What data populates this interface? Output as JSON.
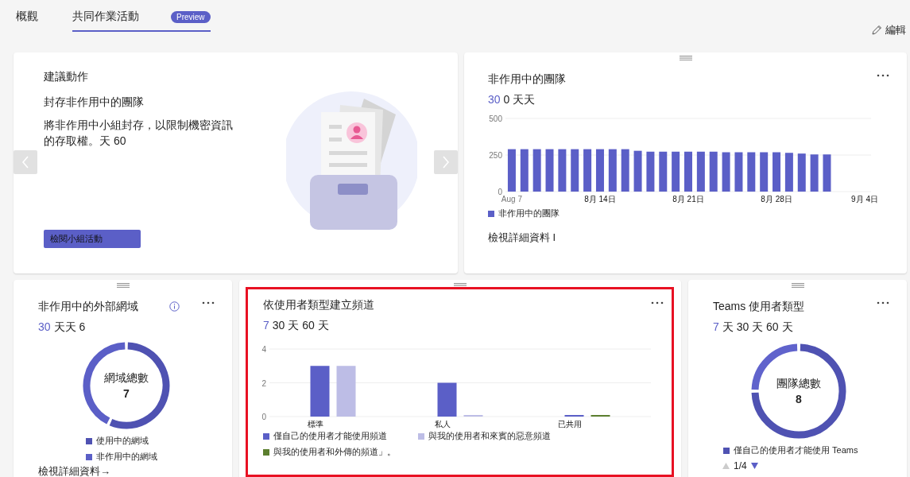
{
  "tabs": [
    {
      "label": "概觀",
      "selected": false
    },
    {
      "label": "共同作業活動",
      "selected": true,
      "badge": "Preview"
    }
  ],
  "edit_button": {
    "label": "編輯"
  },
  "action_card": {
    "title": "建議動作",
    "heading": "封存非作用中的團隊",
    "body": "將非作用中小組封存，以限制機密資訊的存取權。天 60",
    "button": "檢閱小組活動"
  },
  "inactive_teams_card": {
    "title": "非作用中的團隊",
    "periods": [
      {
        "label": "30",
        "selected": true
      },
      {
        "label": "0 天天",
        "selected": false
      }
    ],
    "chart_data": {
      "type": "bar",
      "categories": [
        "Aug 7",
        null,
        null,
        null,
        null,
        null,
        null,
        "8月 14日",
        null,
        null,
        null,
        null,
        null,
        null,
        "8月 21日",
        null,
        null,
        null,
        null,
        null,
        null,
        "8月 28日",
        null,
        null,
        null,
        null,
        null,
        null,
        "9月 4日"
      ],
      "ylim": [
        0,
        500
      ],
      "yticks": [
        0,
        250,
        500
      ],
      "series": [
        {
          "name": "非作用中的團隊",
          "color": "#5b5fc7",
          "values": [
            290,
            290,
            290,
            290,
            290,
            290,
            290,
            290,
            290,
            290,
            279,
            273,
            273,
            273,
            273,
            273,
            273,
            269,
            269,
            269,
            269,
            269,
            265,
            260,
            254,
            254,
            null,
            null,
            null
          ]
        }
      ]
    },
    "link": "檢視詳細資料 I"
  },
  "domains_card": {
    "title": "非作用中的外部網域",
    "periods": [
      {
        "label": "30",
        "selected": true
      },
      {
        "label": "天天 6",
        "selected": false
      }
    ],
    "center_label": "網域總數",
    "center_value": "7",
    "legend": [
      {
        "label": "使用中的網域",
        "color": "#4f52b2"
      },
      {
        "label": "非作用中的網域",
        "color": "#5b5fc7"
      }
    ],
    "link": "檢視詳細資料→"
  },
  "channels_card": {
    "title": "依使用者類型建立頻道",
    "highlighted": true,
    "periods": [
      {
        "label": "7",
        "selected": true
      },
      {
        "label": "30 天 60 天",
        "selected": false
      }
    ],
    "chart_data": {
      "type": "bar",
      "categories": [
        "標準",
        "私人",
        "已共用"
      ],
      "ylim": [
        0,
        4
      ],
      "yticks": [
        0,
        2,
        4
      ],
      "series": [
        {
          "name": "僅自己的使用者才能使用頻道",
          "color": "#5b5fc7",
          "values": [
            3,
            2,
            0
          ]
        },
        {
          "name": "與我的使用者和來賓的惡意頻道",
          "color": "#bdbde6",
          "values": [
            3,
            0,
            null
          ]
        },
        {
          "name": "與我的使用者和外傳的頻道」。",
          "color": "#5c7f2f",
          "values": [
            null,
            null,
            0
          ]
        }
      ]
    }
  },
  "teams_card": {
    "title": "Teams 使用者類型",
    "periods": [
      {
        "label": "7",
        "selected": true
      },
      {
        "label": "天 30 天 60 天",
        "selected": false
      }
    ],
    "center_label": "團隊總數",
    "center_value": "8",
    "legend": [
      {
        "label": "僅自己的使用者才能使用 Teams",
        "color": "#4f52b2"
      }
    ],
    "pager": {
      "label": "1/4",
      "prev_disabled": true,
      "next_disabled": false
    }
  }
}
